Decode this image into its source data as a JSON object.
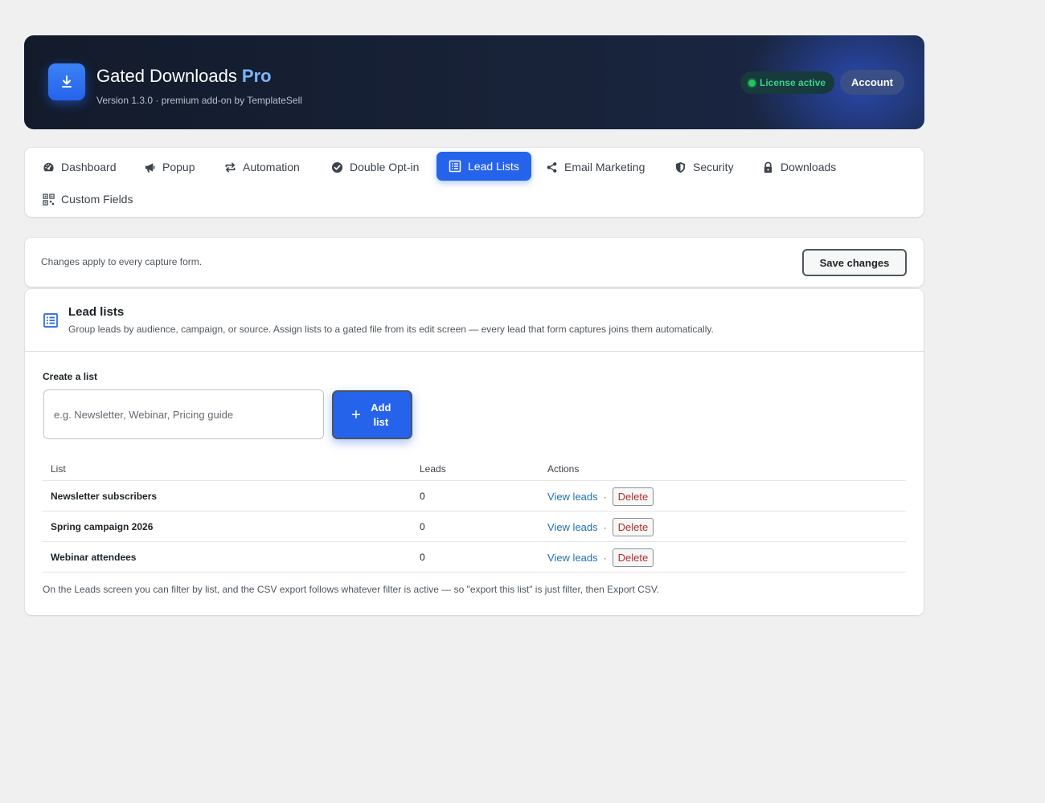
{
  "header": {
    "title": "Gated Downloads",
    "title_badge": "Pro",
    "subtitle": "Version 1.3.0 · premium add-on by TemplateSell",
    "license_status": "License active",
    "account_label": "Account"
  },
  "tabs": [
    {
      "label": "Dashboard",
      "icon": "dashboard-icon",
      "active": false
    },
    {
      "label": "Popup",
      "icon": "megaphone-icon",
      "active": false
    },
    {
      "label": "Automation",
      "icon": "repeat-icon",
      "active": false
    },
    {
      "label": "Double Opt-in",
      "icon": "check-circle-icon",
      "active": false
    },
    {
      "label": "Lead Lists",
      "icon": "list-icon",
      "active": true
    },
    {
      "label": "Email Marketing",
      "icon": "share-icon",
      "active": false
    },
    {
      "label": "Security",
      "icon": "shield-icon",
      "active": false
    },
    {
      "label": "Downloads",
      "icon": "lock-icon",
      "active": false
    },
    {
      "label": "Custom Fields",
      "icon": "qr-grid-icon",
      "active": false
    }
  ],
  "save_bar": {
    "note": "Changes apply to every capture form.",
    "save_label": "Save changes"
  },
  "lead_lists": {
    "title": "Lead lists",
    "description": "Group leads by audience, campaign, or source. Assign lists to a gated file from its edit screen — every lead that form captures joins them automatically.",
    "create_label": "Create a list",
    "input_placeholder": "e.g. Newsletter, Webinar, Pricing guide",
    "input_value": "",
    "add_label": "Add list",
    "columns": [
      "List",
      "Leads",
      "Actions"
    ],
    "rows": [
      {
        "name": "Newsletter subscribers",
        "leads": "0",
        "view_label": "View leads",
        "delete_label": "Delete"
      },
      {
        "name": "Spring campaign 2026",
        "leads": "0",
        "view_label": "View leads",
        "delete_label": "Delete"
      },
      {
        "name": "Webinar attendees",
        "leads": "0",
        "view_label": "View leads",
        "delete_label": "Delete"
      }
    ],
    "separator": "·",
    "footnote": "On the Leads screen you can filter by list, and the CSV export follows whatever filter is active — so \"export this list\" is just filter, then Export CSV."
  },
  "colors": {
    "accent": "#2563eb",
    "license_green": "#3ecf8e",
    "danger": "#b32d2e",
    "link": "#2271b1"
  }
}
